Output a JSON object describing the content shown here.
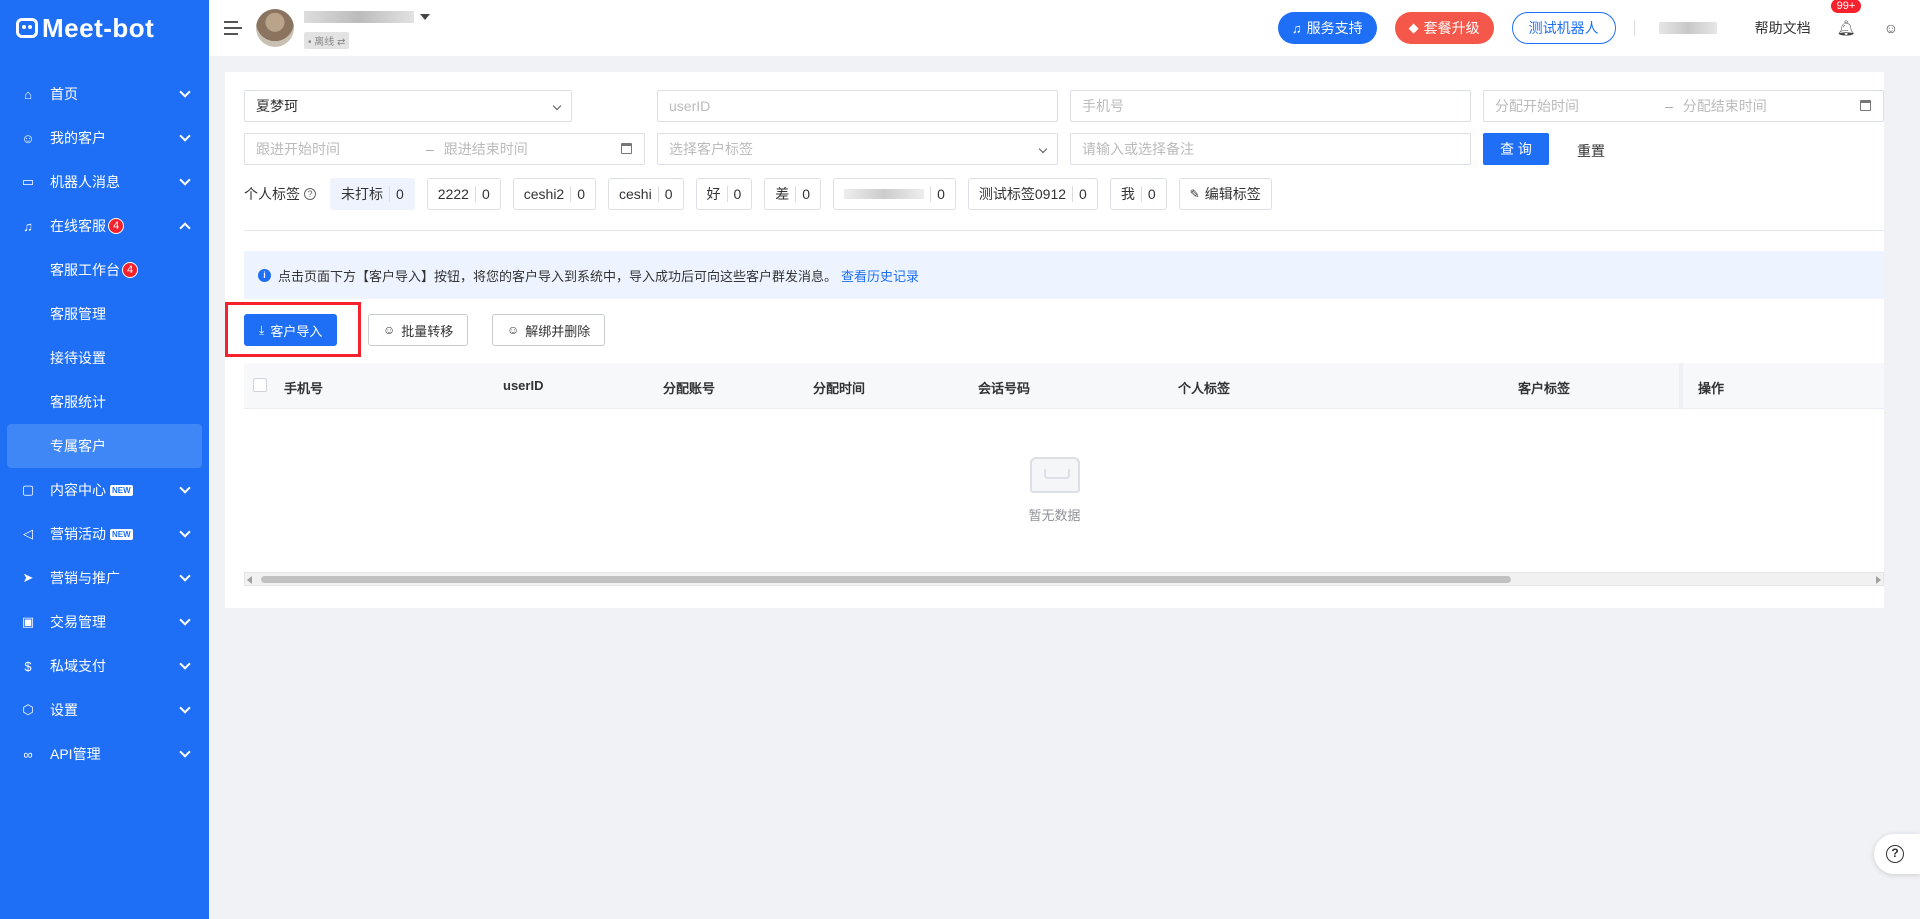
{
  "brand": {
    "name": "Meet-bot"
  },
  "sidebar": {
    "items": [
      {
        "label": "首页",
        "icon": "home-icon"
      },
      {
        "label": "我的客户",
        "icon": "user-icon"
      },
      {
        "label": "机器人消息",
        "icon": "message-icon"
      },
      {
        "label": "在线客服",
        "icon": "headset-icon",
        "badge": "4",
        "expanded": true,
        "children": [
          {
            "label": "客服工作台",
            "badge": "4"
          },
          {
            "label": "客服管理"
          },
          {
            "label": "接待设置"
          },
          {
            "label": "客服统计"
          },
          {
            "label": "专属客户",
            "active": true
          }
        ]
      },
      {
        "label": "内容中心",
        "icon": "content-icon",
        "new": "NEW"
      },
      {
        "label": "营销活动",
        "icon": "megaphone-icon",
        "new": "NEW"
      },
      {
        "label": "营销与推广",
        "icon": "send-icon"
      },
      {
        "label": "交易管理",
        "icon": "bag-icon"
      },
      {
        "label": "私域支付",
        "icon": "coin-icon"
      },
      {
        "label": "设置",
        "icon": "settings-icon"
      },
      {
        "label": "API管理",
        "icon": "link-icon"
      }
    ]
  },
  "header": {
    "account_status": "• 离线 ⇄",
    "service_support": "服务支持",
    "upgrade": "套餐升级",
    "test_robot": "测试机器人",
    "help_docs": "帮助文档",
    "notif_count": "99+"
  },
  "filters": {
    "staff_value": "夏梦珂",
    "userid_placeholder": "userID",
    "phone_placeholder": "手机号",
    "assign_start_placeholder": "分配开始时间",
    "assign_end_placeholder": "分配结束时间",
    "follow_start_placeholder": "跟进开始时间",
    "follow_end_placeholder": "跟进结束时间",
    "customer_tag_placeholder": "选择客户标签",
    "remark_placeholder": "请输入或选择备注",
    "query_label": "查 询",
    "reset_label": "重置",
    "date_sep": "–"
  },
  "tags": {
    "label": "个人标签",
    "items": [
      {
        "name": "未打标",
        "count": "0",
        "selected": true
      },
      {
        "name": "2222",
        "count": "0"
      },
      {
        "name": "ceshi2",
        "count": "0"
      },
      {
        "name": "ceshi",
        "count": "0"
      },
      {
        "name": "好",
        "count": "0"
      },
      {
        "name": "差",
        "count": "0"
      },
      {
        "name": "",
        "count": "0",
        "blurred": true
      },
      {
        "name": "测试标签0912",
        "count": "0"
      },
      {
        "name": "我",
        "count": "0"
      }
    ],
    "edit_label": "编辑标签"
  },
  "notice": {
    "text": "点击页面下方【客户导入】按钮，将您的客户导入到系统中，导入成功后可向这些客户群发消息。",
    "link": "查看历史记录"
  },
  "actions": {
    "import": "客户导入",
    "batch_transfer": "批量转移",
    "unbind_delete": "解绑并删除"
  },
  "table": {
    "columns": [
      "手机号",
      "userID",
      "分配账号",
      "分配时间",
      "会话号码",
      "个人标签",
      "客户标签",
      "操作"
    ],
    "empty_text": "暂无数据"
  },
  "colors": {
    "primary": "#1e6ff5",
    "danger": "#f5222d",
    "upgrade": "#f5574a"
  }
}
